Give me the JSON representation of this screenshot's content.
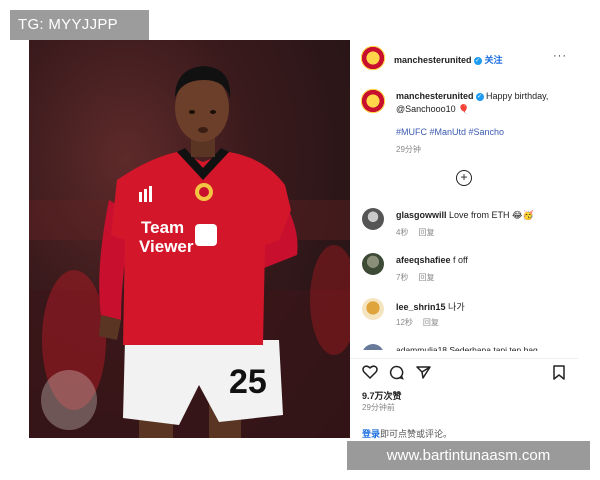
{
  "watermark_top": "TG: MYYJJPP",
  "watermark_bottom": "www.bartintunaasm.com",
  "post": {
    "account": "manchesterunited",
    "follow_label": "关注",
    "more_label": "···",
    "caption": {
      "username": "manchesterunited",
      "text": "Happy birthday, @Sanchooo10 🎈",
      "hashtags": "#MUFC #ManUtd #Sancho",
      "time": "29分钟"
    },
    "comments": [
      {
        "username": "glasgowwill",
        "text": "Love from ETH 😂🥳",
        "time": "4秒",
        "reply": "回复"
      },
      {
        "username": "afeeqshafiee",
        "text": "f off",
        "time": "7秒",
        "reply": "回复"
      },
      {
        "username": "lee_shrin15",
        "text": "나가",
        "time": "12秒",
        "reply": "回复"
      }
    ],
    "partial_comment": "adammulia18 Sederhana tapi ten bag",
    "likes": "9.7万次赞",
    "posted": "29分钟前",
    "login_link": "登录",
    "login_text": "即可点赞或评论。"
  },
  "photo": {
    "sponsor_line1": "Team",
    "sponsor_line2": "Viewer",
    "shorts_number": "25"
  },
  "colors": {
    "shirt_red": "#d3162a",
    "link_blue": "#1d6fe0",
    "hashtag_blue": "#3b5bb0"
  }
}
